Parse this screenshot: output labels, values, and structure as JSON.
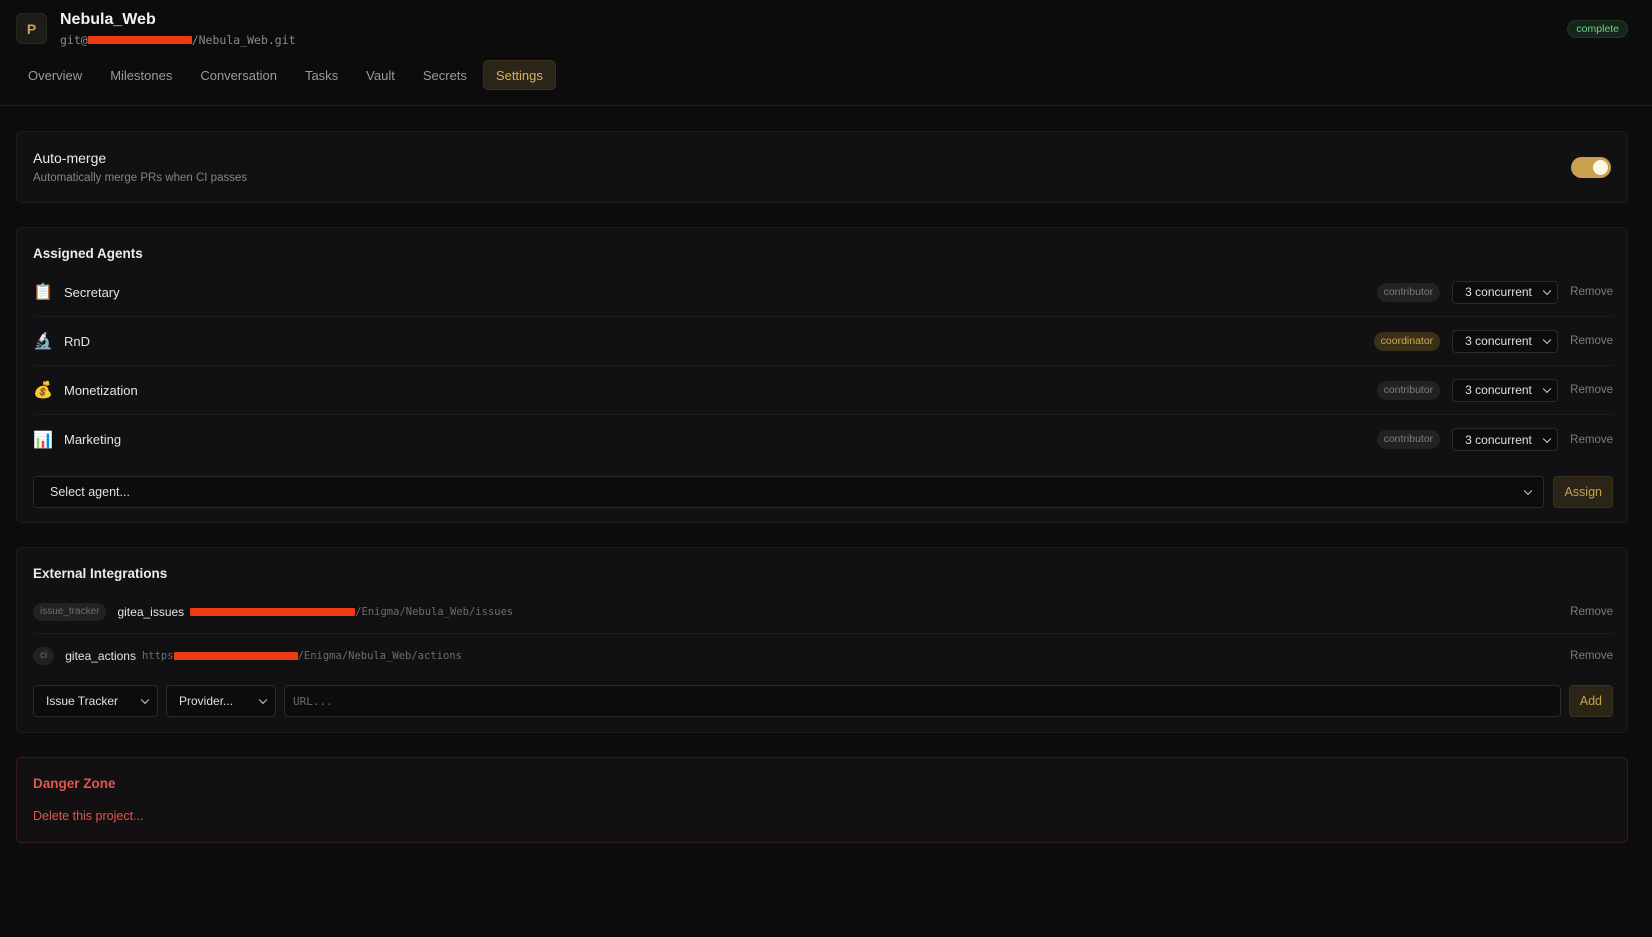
{
  "project": {
    "avatar_letter": "P",
    "title": "Nebula_Web",
    "url_prefix": "git@",
    "url_suffix": "/Nebula_Web.git",
    "status": "complete"
  },
  "tabs": [
    {
      "label": "Overview",
      "active": false
    },
    {
      "label": "Milestones",
      "active": false
    },
    {
      "label": "Conversation",
      "active": false
    },
    {
      "label": "Tasks",
      "active": false
    },
    {
      "label": "Vault",
      "active": false
    },
    {
      "label": "Secrets",
      "active": false
    },
    {
      "label": "Settings",
      "active": true
    }
  ],
  "automerge": {
    "title": "Auto-merge",
    "description": "Automatically merge PRs when CI passes",
    "enabled": true
  },
  "agents": {
    "title": "Assigned Agents",
    "items": [
      {
        "icon": "clipboard-icon",
        "glyph": "📋",
        "name": "Secretary",
        "role": "contributor",
        "concurrency": "3 concurrent",
        "remove": "Remove"
      },
      {
        "icon": "microscope-icon",
        "glyph": "🔬",
        "name": "RnD",
        "role": "coordinator",
        "concurrency": "3 concurrent",
        "remove": "Remove"
      },
      {
        "icon": "money-bag-icon",
        "glyph": "💰",
        "name": "Monetization",
        "role": "contributor",
        "concurrency": "3 concurrent",
        "remove": "Remove"
      },
      {
        "icon": "bar-chart-icon",
        "glyph": "📊",
        "name": "Marketing",
        "role": "contributor",
        "concurrency": "3 concurrent",
        "remove": "Remove"
      }
    ],
    "select_placeholder": "Select agent...",
    "assign_label": "Assign"
  },
  "integrations": {
    "title": "External Integrations",
    "items": [
      {
        "type": "issue_tracker",
        "name": "gitea_issues",
        "url_prefix": "",
        "url_suffix": "/Enigma/Nebula_Web/issues",
        "remove": "Remove"
      },
      {
        "type": "ci",
        "name": "gitea_actions",
        "url_prefix": "https",
        "url_suffix": "/Enigma/Nebula_Web/actions",
        "remove": "Remove"
      }
    ],
    "type_select": "Issue Tracker",
    "provider_select": "Provider...",
    "url_placeholder": "URL...",
    "add_label": "Add"
  },
  "danger": {
    "title": "Danger Zone",
    "delete_label": "Delete this project..."
  },
  "colors": {
    "accent": "#c9a24f",
    "danger": "#e0574f",
    "success": "#6fcf8a",
    "redaction": "#ee3b12"
  }
}
